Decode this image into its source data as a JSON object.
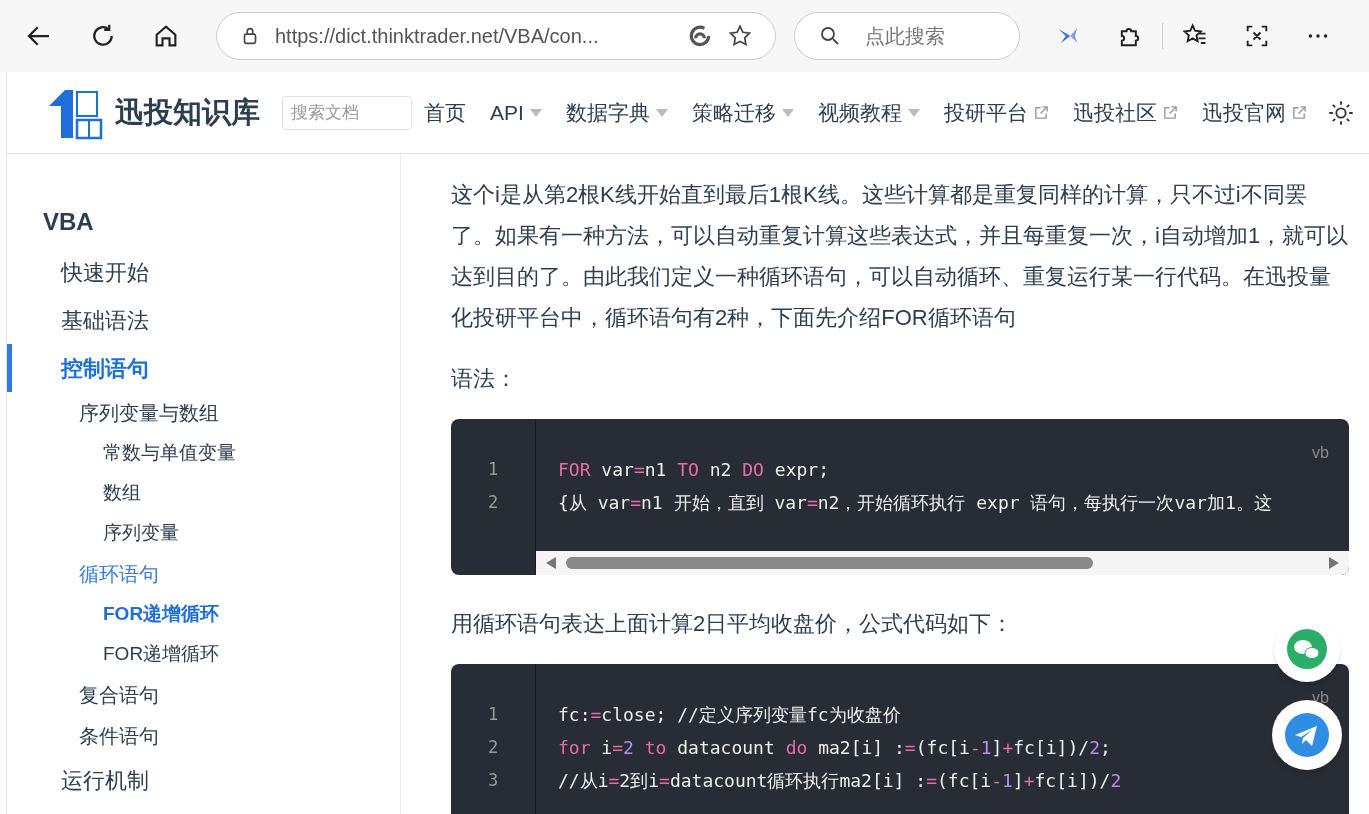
{
  "browser": {
    "url": "https://dict.thinktrader.net/VBA/con...",
    "search_placeholder": "点此搜索"
  },
  "header": {
    "site_title": "迅投知识库",
    "search_placeholder": "搜索文档",
    "nav": [
      {
        "label": "首页",
        "dropdown": false,
        "external": false
      },
      {
        "label": "API",
        "dropdown": true,
        "external": false
      },
      {
        "label": "数据字典",
        "dropdown": true,
        "external": false
      },
      {
        "label": "策略迁移",
        "dropdown": true,
        "external": false
      },
      {
        "label": "视频教程",
        "dropdown": true,
        "external": false
      },
      {
        "label": "投研平台",
        "dropdown": false,
        "external": true
      },
      {
        "label": "迅投社区",
        "dropdown": false,
        "external": true
      },
      {
        "label": "迅投官网",
        "dropdown": false,
        "external": true
      }
    ]
  },
  "sidebar": {
    "heading": "VBA",
    "items": [
      {
        "label": "快速开始",
        "selected": false
      },
      {
        "label": "基础语法",
        "selected": false
      },
      {
        "label": "控制语句",
        "selected": false,
        "children": [
          {
            "label": "序列变量与数组",
            "selected": false,
            "children": [
              {
                "label": "常数与单值变量",
                "selected": false
              },
              {
                "label": "数组",
                "selected": false
              },
              {
                "label": "序列变量",
                "selected": false
              }
            ]
          },
          {
            "label": "循环语句",
            "selected": false,
            "children": [
              {
                "label": "FOR递增循环",
                "selected": true
              },
              {
                "label": "FOR递增循环",
                "selected": false
              }
            ]
          },
          {
            "label": "复合语句",
            "selected": false
          },
          {
            "label": "条件语句",
            "selected": false
          }
        ]
      },
      {
        "label": "运行机制",
        "selected": false
      }
    ]
  },
  "content": [
    {
      "kind": "paragraph",
      "text": "这个i是从第2根K线开始直到最后1根K线。这些计算都是重复同样的计算，只不过i不同罢了。如果有一种方法，可以自动重复计算这些表达式，并且每重复一次，i自动增加1，就可以达到目的了。由此我们定义一种循环语句，可以自动循环、重复运行某一行代码。在迅投量化投研平台中，循环语句有2种，下面先介绍FOR循环语句"
    },
    {
      "kind": "paragraph",
      "text": "语法："
    },
    {
      "kind": "code",
      "language": "vb",
      "scrollbar": true,
      "lines": [
        {
          "number": "1",
          "tokens": [
            {
              "kind": "keyword",
              "text": "FOR"
            },
            {
              "kind": "plain",
              "text": " var"
            },
            {
              "kind": "operator",
              "text": "="
            },
            {
              "kind": "plain",
              "text": "n1 "
            },
            {
              "kind": "keyword",
              "text": "TO"
            },
            {
              "kind": "plain",
              "text": " n2 "
            },
            {
              "kind": "keyword",
              "text": "DO"
            },
            {
              "kind": "plain",
              "text": " expr;"
            }
          ]
        },
        {
          "number": "2",
          "tokens": [
            {
              "kind": "plain",
              "text": "{从 var"
            },
            {
              "kind": "operator",
              "text": "="
            },
            {
              "kind": "plain",
              "text": "n1 开始，直到 var"
            },
            {
              "kind": "operator",
              "text": "="
            },
            {
              "kind": "plain",
              "text": "n2，开始循环执行 expr 语句，每执行一次var加1。这"
            }
          ]
        }
      ]
    },
    {
      "kind": "paragraph",
      "text": "用循环语句表达上面计算2日平均收盘价，公式代码如下："
    },
    {
      "kind": "code",
      "language": "vb",
      "scrollbar": false,
      "lines": [
        {
          "number": "1",
          "tokens": [
            {
              "kind": "plain",
              "text": "fc:"
            },
            {
              "kind": "operator",
              "text": "="
            },
            {
              "kind": "plain",
              "text": "close; //定义序列变量fc为收盘价"
            }
          ]
        },
        {
          "number": "2",
          "tokens": [
            {
              "kind": "keyword",
              "text": "for"
            },
            {
              "kind": "plain",
              "text": " i"
            },
            {
              "kind": "operator",
              "text": "="
            },
            {
              "kind": "number",
              "text": "2"
            },
            {
              "kind": "keyword",
              "text": " to"
            },
            {
              "kind": "plain",
              "text": " datacount "
            },
            {
              "kind": "keyword",
              "text": "do"
            },
            {
              "kind": "plain",
              "text": " ma2[i] :"
            },
            {
              "kind": "operator",
              "text": "="
            },
            {
              "kind": "plain",
              "text": "(fc[i"
            },
            {
              "kind": "operator",
              "text": "-"
            },
            {
              "kind": "number",
              "text": "1"
            },
            {
              "kind": "plain",
              "text": "]"
            },
            {
              "kind": "operator",
              "text": "+"
            },
            {
              "kind": "plain",
              "text": "fc[i])/"
            },
            {
              "kind": "number",
              "text": "2"
            },
            {
              "kind": "plain",
              "text": ";"
            }
          ]
        },
        {
          "number": "3",
          "tokens": [
            {
              "kind": "plain",
              "text": "//从i"
            },
            {
              "kind": "operator",
              "text": "="
            },
            {
              "kind": "plain",
              "text": "2到i"
            },
            {
              "kind": "operator",
              "text": "="
            },
            {
              "kind": "plain",
              "text": "datacount循环执行ma2[i] :"
            },
            {
              "kind": "operator",
              "text": "="
            },
            {
              "kind": "plain",
              "text": "(fc[i"
            },
            {
              "kind": "operator",
              "text": "-"
            },
            {
              "kind": "number",
              "text": "1"
            },
            {
              "kind": "plain",
              "text": "]"
            },
            {
              "kind": "operator",
              "text": "+"
            },
            {
              "kind": "plain",
              "text": "fc[i])/"
            },
            {
              "kind": "number",
              "text": "2"
            }
          ]
        }
      ]
    }
  ]
}
